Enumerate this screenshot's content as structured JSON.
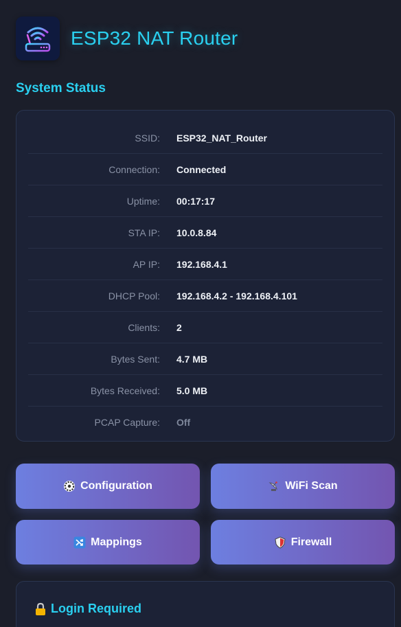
{
  "app": {
    "title": "ESP32 NAT Router",
    "logo_icon": "wifi-router-icon"
  },
  "status": {
    "section_title": "System Status",
    "rows": [
      {
        "label": "SSID:",
        "value": "ESP32_NAT_Router"
      },
      {
        "label": "Connection:",
        "value": "Connected"
      },
      {
        "label": "Uptime:",
        "value": "00:17:17"
      },
      {
        "label": "STA IP:",
        "value": "10.0.8.84"
      },
      {
        "label": "AP IP:",
        "value": "192.168.4.1"
      },
      {
        "label": "DHCP Pool:",
        "value": "192.168.4.2 - 192.168.4.101"
      },
      {
        "label": "Clients:",
        "value": "2"
      },
      {
        "label": "Bytes Sent:",
        "value": "4.7 MB"
      },
      {
        "label": "Bytes Received:",
        "value": "5.0 MB"
      },
      {
        "label": "PCAP Capture:",
        "value": "Off"
      }
    ]
  },
  "actions": {
    "configuration": {
      "label": "Configuration",
      "icon": "gear-icon"
    },
    "wifi_scan": {
      "label": "WiFi Scan",
      "icon": "satellite-dish-icon"
    },
    "mappings": {
      "label": "Mappings",
      "icon": "shuffle-icon"
    },
    "firewall": {
      "label": "Firewall",
      "icon": "shield-icon"
    }
  },
  "login": {
    "title": "Login Required",
    "icon": "lock-icon"
  },
  "colors": {
    "accent": "#2ad0f0",
    "background": "#1b1e2a",
    "card": "#1c2236",
    "button_gradient_start": "#6d7fe0",
    "button_gradient_end": "#7355b0"
  }
}
